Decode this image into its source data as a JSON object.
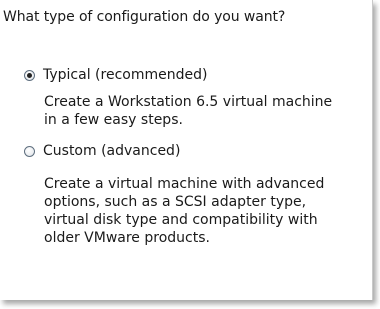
{
  "question": "What type of configuration do you want?",
  "options": [
    {
      "label": "Typical (recommended)",
      "selected": true,
      "description_lines": [
        "Create a Workstation 6.5 virtual machine",
        "in a few easy steps."
      ]
    },
    {
      "label": "Custom (advanced)",
      "selected": false,
      "description_lines": [
        "Create a virtual machine with advanced",
        "options, such as a SCSI adapter type,",
        "virtual disk type and compatibility with",
        "older VMware products."
      ]
    }
  ]
}
